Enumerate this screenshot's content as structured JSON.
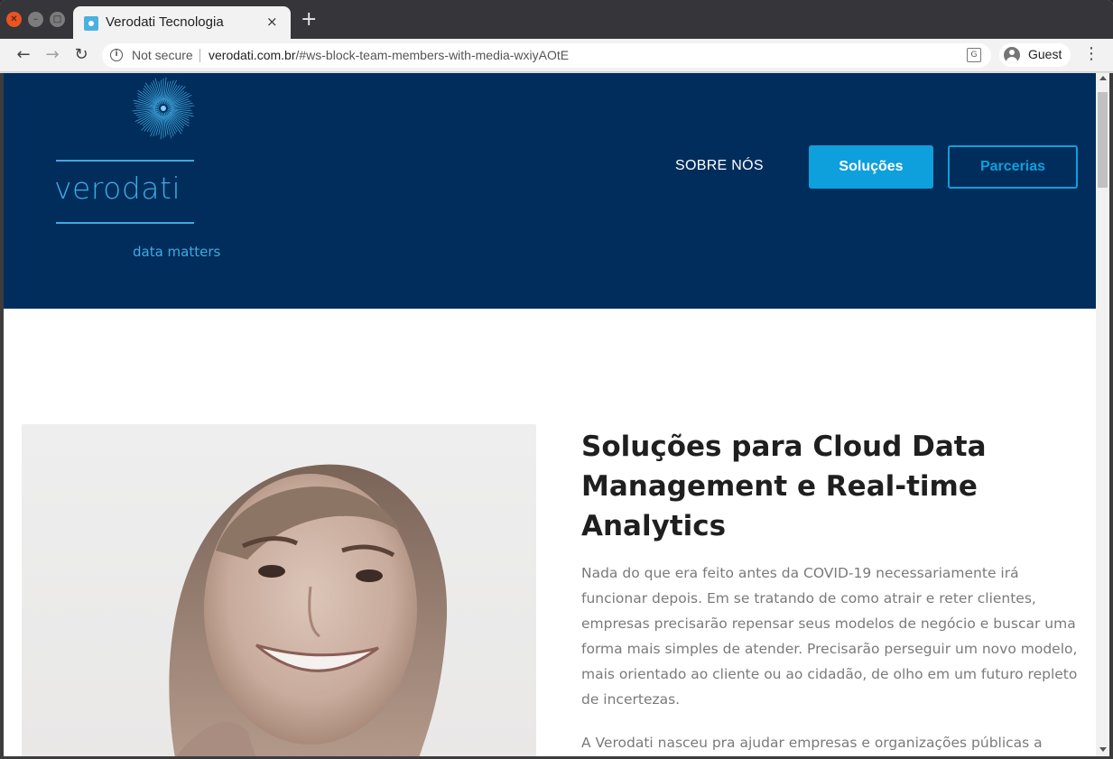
{
  "browser": {
    "tab_title": "Verodati Tecnologia",
    "tab_close": "×",
    "new_tab": "+",
    "security_label": "Not secure",
    "url_host": "verodati.com.br",
    "url_path": "/#ws-block-team-members-with-media-wxiyAOtE",
    "profile_label": "Guest",
    "back_glyph": "←",
    "forward_glyph": "→",
    "reload_glyph": "↻",
    "menu_glyph": "⋮"
  },
  "header": {
    "logo_word": "verodati",
    "tagline": "data matters",
    "nav": {
      "sobre": "SOBRE NÓS",
      "solucoes": "Soluções",
      "parcerias": "Parcerias"
    },
    "colors": {
      "background": "#002d5c",
      "accent": "#0ea0dc",
      "logo": "#41a9e0"
    }
  },
  "content": {
    "title": "Soluções para Cloud Data Management e Real-time Analytics",
    "paragraph_1": "Nada do que era feito antes da COVID-19 necessariamente irá funcionar depois. Em se tratando de como atrair e reter clientes, empresas precisarão repensar seus modelos de negócio e buscar uma forma mais simples de atender. Precisarão perseguir um novo modelo, mais orientado ao cliente ou ao cidadão, de olho em um futuro repleto de incertezas.",
    "paragraph_2": "A Verodati nasceu pra ajudar empresas e organizações públicas a"
  }
}
